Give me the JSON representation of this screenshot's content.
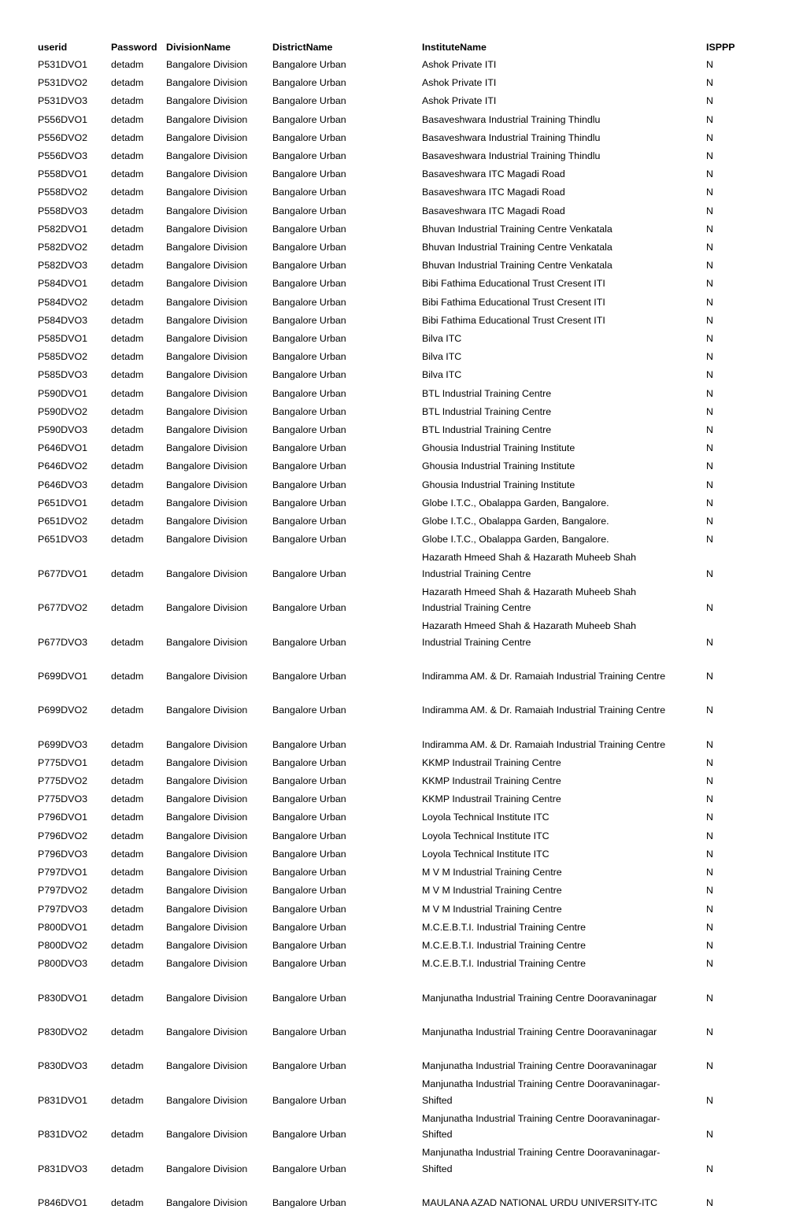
{
  "document": {
    "title": "ITI User Credentials Listing",
    "page_background": "#ffffff",
    "text_color": "#000000"
  },
  "table": {
    "columns": [
      {
        "key": "userid",
        "label": "userid"
      },
      {
        "key": "password",
        "label": "Password"
      },
      {
        "key": "division",
        "label": "DivisionName"
      },
      {
        "key": "district",
        "label": "DistrictName"
      },
      {
        "key": "institute",
        "label": "InstituteName"
      },
      {
        "key": "isppp",
        "label": "ISPPP"
      }
    ],
    "rows": [
      {
        "userid": "P531DVO1",
        "password": "detadm",
        "division": "Bangalore Division",
        "district": "Bangalore Urban",
        "institute": "Ashok Private ITI",
        "isppp": "N",
        "style": "single"
      },
      {
        "userid": "P531DVO2",
        "password": "detadm",
        "division": "Bangalore Division",
        "district": "Bangalore Urban",
        "institute": "Ashok Private ITI",
        "isppp": "N",
        "style": "single"
      },
      {
        "userid": "P531DVO3",
        "password": "detadm",
        "division": "Bangalore Division",
        "district": "Bangalore Urban",
        "institute": "Ashok Private ITI",
        "isppp": "N",
        "style": "single"
      },
      {
        "userid": "P556DVO1",
        "password": "detadm",
        "division": "Bangalore Division",
        "district": "Bangalore Urban",
        "institute": "Basaveshwara Industrial Training Thindlu",
        "isppp": "N",
        "style": "single"
      },
      {
        "userid": "P556DVO2",
        "password": "detadm",
        "division": "Bangalore Division",
        "district": "Bangalore Urban",
        "institute": "Basaveshwara Industrial Training Thindlu",
        "isppp": "N",
        "style": "single"
      },
      {
        "userid": "P556DVO3",
        "password": "detadm",
        "division": "Bangalore Division",
        "district": "Bangalore Urban",
        "institute": "Basaveshwara Industrial Training Thindlu",
        "isppp": "N",
        "style": "single"
      },
      {
        "userid": "P558DVO1",
        "password": "detadm",
        "division": "Bangalore Division",
        "district": "Bangalore Urban",
        "institute": "Basaveshwara ITC Magadi Road",
        "isppp": "N",
        "style": "single"
      },
      {
        "userid": "P558DVO2",
        "password": "detadm",
        "division": "Bangalore Division",
        "district": "Bangalore Urban",
        "institute": "Basaveshwara ITC Magadi Road",
        "isppp": "N",
        "style": "single"
      },
      {
        "userid": "P558DVO3",
        "password": "detadm",
        "division": "Bangalore Division",
        "district": "Bangalore Urban",
        "institute": "Basaveshwara ITC Magadi Road",
        "isppp": "N",
        "style": "single"
      },
      {
        "userid": "P582DVO1",
        "password": "detadm",
        "division": "Bangalore Division",
        "district": "Bangalore Urban",
        "institute": "Bhuvan Industrial Training Centre Venkatala",
        "isppp": "N",
        "style": "single"
      },
      {
        "userid": "P582DVO2",
        "password": "detadm",
        "division": "Bangalore Division",
        "district": "Bangalore Urban",
        "institute": "Bhuvan Industrial Training Centre Venkatala",
        "isppp": "N",
        "style": "single"
      },
      {
        "userid": "P582DVO3",
        "password": "detadm",
        "division": "Bangalore Division",
        "district": "Bangalore Urban",
        "institute": "Bhuvan Industrial Training Centre Venkatala",
        "isppp": "N",
        "style": "single"
      },
      {
        "userid": "P584DVO1",
        "password": "detadm",
        "division": "Bangalore Division",
        "district": "Bangalore Urban",
        "institute": "Bibi Fathima Educational Trust Cresent ITI",
        "isppp": "N",
        "style": "single"
      },
      {
        "userid": "P584DVO2",
        "password": "detadm",
        "division": "Bangalore Division",
        "district": "Bangalore Urban",
        "institute": "Bibi Fathima Educational Trust Cresent ITI",
        "isppp": "N",
        "style": "single"
      },
      {
        "userid": "P584DVO3",
        "password": "detadm",
        "division": "Bangalore Division",
        "district": "Bangalore Urban",
        "institute": "Bibi Fathima Educational Trust Cresent ITI",
        "isppp": "N",
        "style": "single"
      },
      {
        "userid": "P585DVO1",
        "password": "detadm",
        "division": "Bangalore Division",
        "district": "Bangalore Urban",
        "institute": "Bilva ITC",
        "isppp": "N",
        "style": "single"
      },
      {
        "userid": "P585DVO2",
        "password": "detadm",
        "division": "Bangalore Division",
        "district": "Bangalore Urban",
        "institute": "Bilva ITC",
        "isppp": "N",
        "style": "single"
      },
      {
        "userid": "P585DVO3",
        "password": "detadm",
        "division": "Bangalore Division",
        "district": "Bangalore Urban",
        "institute": "Bilva ITC",
        "isppp": "N",
        "style": "single"
      },
      {
        "userid": "P590DVO1",
        "password": "detadm",
        "division": "Bangalore Division",
        "district": "Bangalore Urban",
        "institute": "BTL Industrial Training Centre",
        "isppp": "N",
        "style": "single"
      },
      {
        "userid": "P590DVO2",
        "password": "detadm",
        "division": "Bangalore Division",
        "district": "Bangalore Urban",
        "institute": "BTL Industrial Training Centre",
        "isppp": "N",
        "style": "single"
      },
      {
        "userid": "P590DVO3",
        "password": "detadm",
        "division": "Bangalore Division",
        "district": "Bangalore Urban",
        "institute": "BTL Industrial Training Centre",
        "isppp": "N",
        "style": "single"
      },
      {
        "userid": "P646DVO1",
        "password": "detadm",
        "division": "Bangalore Division",
        "district": "Bangalore Urban",
        "institute": "Ghousia Industrial Training Institute",
        "isppp": "N",
        "style": "single"
      },
      {
        "userid": "P646DVO2",
        "password": "detadm",
        "division": "Bangalore Division",
        "district": "Bangalore Urban",
        "institute": "Ghousia Industrial Training Institute",
        "isppp": "N",
        "style": "single"
      },
      {
        "userid": "P646DVO3",
        "password": "detadm",
        "division": "Bangalore Division",
        "district": "Bangalore Urban",
        "institute": "Ghousia Industrial Training Institute",
        "isppp": "N",
        "style": "single"
      },
      {
        "userid": "P651DVO1",
        "password": "detadm",
        "division": "Bangalore Division",
        "district": "Bangalore Urban",
        "institute": "Globe I.T.C., Obalappa Garden, Bangalore.",
        "isppp": "N",
        "style": "single"
      },
      {
        "userid": "P651DVO2",
        "password": "detadm",
        "division": "Bangalore Division",
        "district": "Bangalore Urban",
        "institute": "Globe I.T.C., Obalappa Garden, Bangalore.",
        "isppp": "N",
        "style": "single"
      },
      {
        "userid": "P651DVO3",
        "password": "detadm",
        "division": "Bangalore Division",
        "district": "Bangalore Urban",
        "institute": "Globe I.T.C., Obalappa Garden, Bangalore.",
        "isppp": "N",
        "style": "single"
      },
      {
        "userid": "P677DVO1",
        "password": "detadm",
        "division": "Bangalore Division",
        "district": "Bangalore Urban",
        "institute": "Hazarath Hmeed Shah & Hazarath Muheeb Shah Industrial Training Centre",
        "institute_line1": "Hazarath Hmeed Shah & Hazarath Muheeb Shah",
        "institute_line2": "Industrial Training Centre",
        "isppp": "N",
        "style": "wrap"
      },
      {
        "userid": "P677DVO2",
        "password": "detadm",
        "division": "Bangalore Division",
        "district": "Bangalore Urban",
        "institute": "Hazarath Hmeed Shah & Hazarath Muheeb Shah Industrial Training Centre",
        "institute_line1": "Hazarath Hmeed Shah & Hazarath Muheeb Shah",
        "institute_line2": "Industrial Training Centre",
        "isppp": "N",
        "style": "wrap"
      },
      {
        "userid": "P677DVO3",
        "password": "detadm",
        "division": "Bangalore Division",
        "district": "Bangalore Urban",
        "institute": "Hazarath Hmeed Shah & Hazarath Muheeb Shah Industrial Training Centre",
        "institute_line1": "Hazarath Hmeed Shah & Hazarath Muheeb Shah",
        "institute_line2": "Industrial Training Centre",
        "isppp": "N",
        "style": "wrap"
      },
      {
        "userid": "P699DVO1",
        "password": "detadm",
        "division": "Bangalore Division",
        "district": "Bangalore Urban",
        "institute": "Indiramma AM. & Dr. Ramaiah Industrial Training Centre",
        "isppp": "N",
        "style": "gap"
      },
      {
        "userid": "P699DVO2",
        "password": "detadm",
        "division": "Bangalore Division",
        "district": "Bangalore Urban",
        "institute": "Indiramma AM. & Dr. Ramaiah Industrial Training Centre",
        "isppp": "N",
        "style": "gap"
      },
      {
        "userid": "P699DVO3",
        "password": "detadm",
        "division": "Bangalore Division",
        "district": "Bangalore Urban",
        "institute": "Indiramma AM. & Dr. Ramaiah Industrial Training Centre",
        "isppp": "N",
        "style": "gap"
      },
      {
        "userid": "P775DVO1",
        "password": "detadm",
        "division": "Bangalore Division",
        "district": "Bangalore Urban",
        "institute": "KKMP Industrail Training Centre",
        "isppp": "N",
        "style": "single"
      },
      {
        "userid": "P775DVO2",
        "password": "detadm",
        "division": "Bangalore Division",
        "district": "Bangalore Urban",
        "institute": "KKMP Industrail Training Centre",
        "isppp": "N",
        "style": "single"
      },
      {
        "userid": "P775DVO3",
        "password": "detadm",
        "division": "Bangalore Division",
        "district": "Bangalore Urban",
        "institute": "KKMP Industrail Training Centre",
        "isppp": "N",
        "style": "single"
      },
      {
        "userid": "P796DVO1",
        "password": "detadm",
        "division": "Bangalore Division",
        "district": "Bangalore Urban",
        "institute": "Loyola Technical Institute ITC",
        "isppp": "N",
        "style": "single"
      },
      {
        "userid": "P796DVO2",
        "password": "detadm",
        "division": "Bangalore Division",
        "district": "Bangalore Urban",
        "institute": "Loyola Technical Institute ITC",
        "isppp": "N",
        "style": "single"
      },
      {
        "userid": "P796DVO3",
        "password": "detadm",
        "division": "Bangalore Division",
        "district": "Bangalore Urban",
        "institute": "Loyola Technical Institute ITC",
        "isppp": "N",
        "style": "single"
      },
      {
        "userid": "P797DVO1",
        "password": "detadm",
        "division": "Bangalore Division",
        "district": "Bangalore Urban",
        "institute": "M V M Industrial Training Centre",
        "isppp": "N",
        "style": "single"
      },
      {
        "userid": "P797DVO2",
        "password": "detadm",
        "division": "Bangalore Division",
        "district": "Bangalore Urban",
        "institute": "M V M Industrial Training Centre",
        "isppp": "N",
        "style": "single"
      },
      {
        "userid": "P797DVO3",
        "password": "detadm",
        "division": "Bangalore Division",
        "district": "Bangalore Urban",
        "institute": "M V M Industrial Training Centre",
        "isppp": "N",
        "style": "single"
      },
      {
        "userid": "P800DVO1",
        "password": "detadm",
        "division": "Bangalore Division",
        "district": "Bangalore Urban",
        "institute": "M.C.E.B.T.I. Industrial Training Centre",
        "isppp": "N",
        "style": "single"
      },
      {
        "userid": "P800DVO2",
        "password": "detadm",
        "division": "Bangalore Division",
        "district": "Bangalore Urban",
        "institute": "M.C.E.B.T.I. Industrial Training Centre",
        "isppp": "N",
        "style": "single"
      },
      {
        "userid": "P800DVO3",
        "password": "detadm",
        "division": "Bangalore Division",
        "district": "Bangalore Urban",
        "institute": "M.C.E.B.T.I. Industrial Training Centre",
        "isppp": "N",
        "style": "single"
      },
      {
        "userid": "P830DVO1",
        "password": "detadm",
        "division": "Bangalore Division",
        "district": "Bangalore Urban",
        "institute": "Manjunatha Industrial Training Centre Dooravaninagar",
        "isppp": "N",
        "style": "gap"
      },
      {
        "userid": "P830DVO2",
        "password": "detadm",
        "division": "Bangalore Division",
        "district": "Bangalore Urban",
        "institute": "Manjunatha Industrial Training Centre Dooravaninagar",
        "isppp": "N",
        "style": "gap"
      },
      {
        "userid": "P830DVO3",
        "password": "detadm",
        "division": "Bangalore Division",
        "district": "Bangalore Urban",
        "institute": "Manjunatha Industrial Training Centre Dooravaninagar",
        "isppp": "N",
        "style": "gap"
      },
      {
        "userid": "P831DVO1",
        "password": "detadm",
        "division": "Bangalore Division",
        "district": "Bangalore Urban",
        "institute": "Manjunatha Industrial Training Centre Dooravaninagar-Shifted",
        "institute_line1": "Manjunatha Industrial Training Centre Dooravaninagar-",
        "institute_line2": "Shifted",
        "isppp": "N",
        "style": "wrap"
      },
      {
        "userid": "P831DVO2",
        "password": "detadm",
        "division": "Bangalore Division",
        "district": "Bangalore Urban",
        "institute": "Manjunatha Industrial Training Centre Dooravaninagar-Shifted",
        "institute_line1": "Manjunatha Industrial Training Centre Dooravaninagar-",
        "institute_line2": "Shifted",
        "isppp": "N",
        "style": "wrap"
      },
      {
        "userid": "P831DVO3",
        "password": "detadm",
        "division": "Bangalore Division",
        "district": "Bangalore Urban",
        "institute": "Manjunatha Industrial Training Centre Dooravaninagar-Shifted",
        "institute_line1": "Manjunatha Industrial Training Centre Dooravaninagar-",
        "institute_line2": "Shifted",
        "isppp": "N",
        "style": "wrap"
      },
      {
        "userid": "P846DVO1",
        "password": "detadm",
        "division": "Bangalore Division",
        "district": "Bangalore Urban",
        "institute": "MAULANA AZAD NATIONAL URDU UNIVERSITY-ITC",
        "isppp": "N",
        "style": "gap"
      }
    ]
  }
}
